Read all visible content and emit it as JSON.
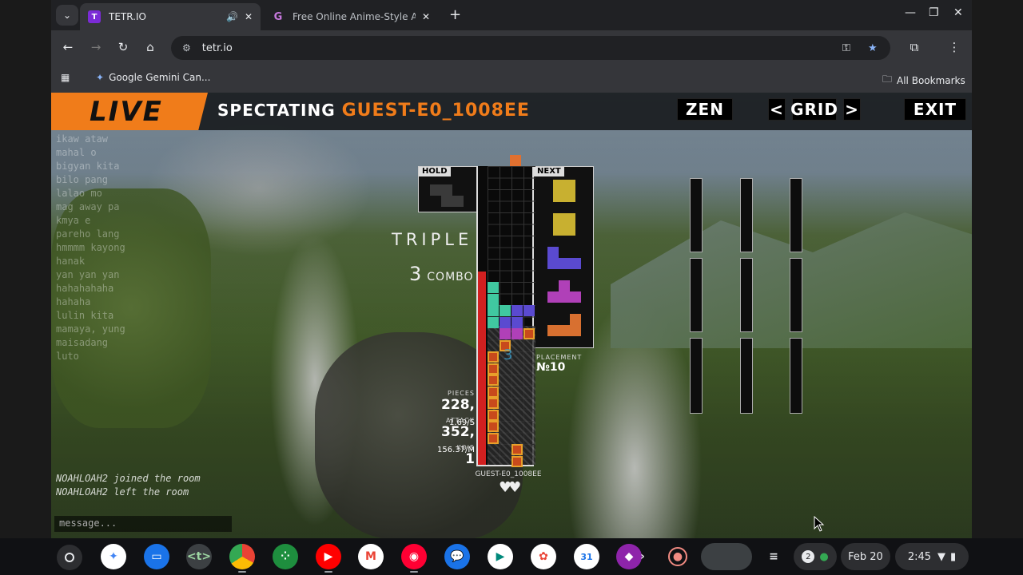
{
  "browser": {
    "tabs": [
      {
        "title": "TETR.IO",
        "active": true
      },
      {
        "title": "Free Online Anime-Style AI GIF",
        "active": false
      }
    ],
    "url": "tetr.io",
    "bookmarks": [
      {
        "label": "Google Gemini Can..."
      }
    ],
    "all_bookmarks_label": "All Bookmarks"
  },
  "game": {
    "live_label": "LIVE",
    "spectating_label": "SPECTATING",
    "player_name": "GUEST-E0_1008EE",
    "zen_label": "ZEN",
    "grid_label": "GRID",
    "exit_label": "EXIT",
    "hold_label": "HOLD",
    "next_label": "NEXT",
    "clear_label": "TRIPLE",
    "combo_count": "3",
    "combo_label": "COMBO",
    "ghost_number": "3",
    "stats": {
      "pieces_label": "PIECES",
      "pieces_value": "228,",
      "pieces_rate": "1.69/S",
      "attack_label": "ATTACK",
      "attack_value": "352,",
      "attack_rate": "156.37/M",
      "kos_label": "KO'S",
      "kos_value": "1"
    },
    "placement_label": "PLACEMENT",
    "placement_value": "№10",
    "board_name": "GUEST-E0_1008EE",
    "next_queue": [
      "O",
      "O",
      "J",
      "T",
      "L"
    ],
    "chat_input_placeholder": "message...",
    "chat": [
      {
        "text": "ikaw ataw",
        "event": false
      },
      {
        "text": "mahal o",
        "event": false
      },
      {
        "text": "bigyan kita",
        "event": false
      },
      {
        "text": "bilo pang",
        "event": false
      },
      {
        "text": "lalao mo",
        "event": false
      },
      {
        "text": "mag away pa",
        "event": false
      },
      {
        "text": "kmya e",
        "event": false
      },
      {
        "text": "pareho lang",
        "event": false
      },
      {
        "text": "hmmmm kayong",
        "event": false
      },
      {
        "text": "hanak",
        "event": false
      },
      {
        "text": "yan yan yan",
        "event": false
      },
      {
        "text": "hahahahaha",
        "event": false
      },
      {
        "text": "hahaha",
        "event": false
      },
      {
        "text": "lulin kita",
        "event": false
      },
      {
        "text": "mamaya, yung",
        "event": false
      },
      {
        "text": "maisadang",
        "event": false
      },
      {
        "text": "luto",
        "event": false
      },
      {
        "text": "",
        "event": false
      },
      {
        "text": "",
        "event": false
      },
      {
        "text": "",
        "event": false
      },
      {
        "text": "",
        "event": false
      },
      {
        "text": "",
        "event": false
      },
      {
        "text": "",
        "event": false
      },
      {
        "text": "",
        "event": false
      },
      {
        "text": "",
        "event": false
      },
      {
        "text": "NOAHLOAH2 joined the room",
        "event": true
      },
      {
        "text": "NOAHLOAH2 left the room",
        "event": true
      }
    ]
  },
  "shelf": {
    "date": "Feb 20",
    "time": "2:45",
    "notification_count": "2"
  }
}
